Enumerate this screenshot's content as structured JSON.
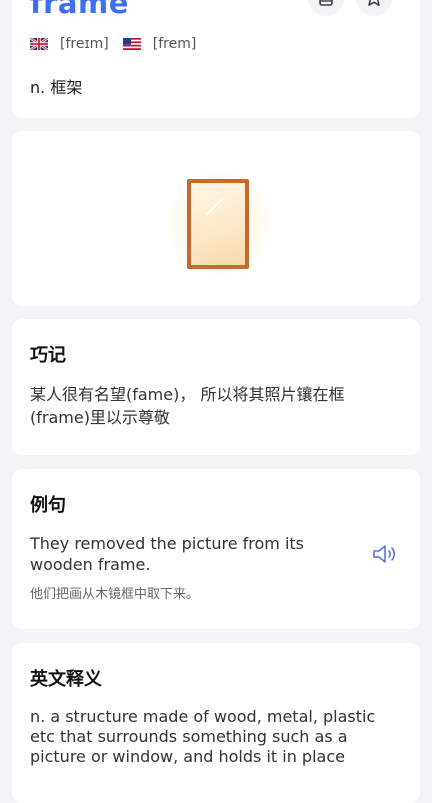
{
  "word": {
    "text": "frame",
    "uk_phonetic": "[freɪm]",
    "us_phonetic": "[frem]",
    "definition": "n. 框架"
  },
  "memory": {
    "title": "巧记",
    "text": "某人很有名望(fame)， 所以将其照片镶在框(frame)里以示尊敬"
  },
  "example": {
    "title": "例句",
    "en": "They removed the picture from its wooden frame.",
    "zh": "他们把画从木镜框中取下来。"
  },
  "english_definition": {
    "title": "英文释义",
    "text": "n. a structure made of wood, metal, plastic etc that surrounds something such as a picture or window, and holds it in place"
  },
  "icons": {
    "wordbook": "book-icon",
    "favorite": "star-icon",
    "uk": "uk-flag-icon",
    "us": "us-flag-icon",
    "illustration": "mirror-frame-icon",
    "audio": "speaker-icon"
  },
  "colors": {
    "accent": "#3d6ef5",
    "frame_wood": "#c46a2a",
    "background": "#f3f4f7"
  }
}
